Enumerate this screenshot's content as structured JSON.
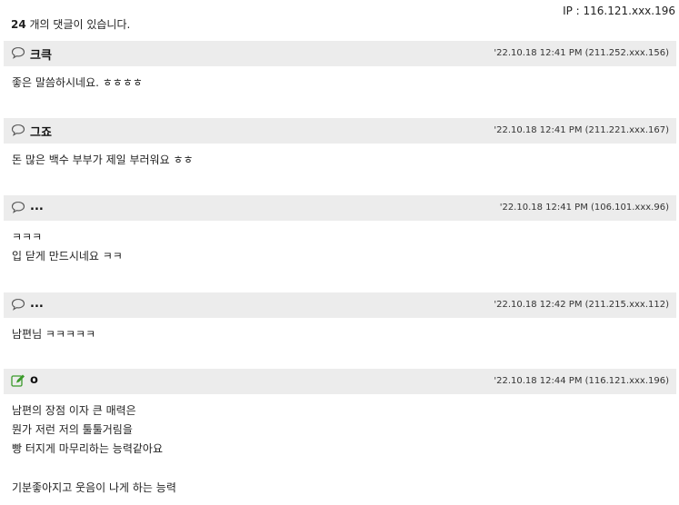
{
  "ip_label": "IP : 116.121.xxx.196",
  "comment_count": "24",
  "comment_count_suffix": " 개의 댓글이 있습니다.",
  "comments": [
    {
      "name": "크큭",
      "meta": "'22.10.18 12:41 PM (211.252.xxx.156)",
      "icon": "speech-bubble-icon",
      "lines": [
        "좋은 말씀하시네요. ㅎㅎㅎㅎ"
      ]
    },
    {
      "name": "그죠",
      "meta": "'22.10.18 12:41 PM (211.221.xxx.167)",
      "icon": "speech-bubble-icon",
      "lines": [
        "돈 많은 백수 부부가 제일 부러워요 ㅎㅎ"
      ]
    },
    {
      "name": "...",
      "meta": "'22.10.18 12:41 PM (106.101.xxx.96)",
      "icon": "speech-bubble-icon",
      "lines": [
        "ㅋㅋㅋ",
        "입 닫게 만드시네요 ㅋㅋ"
      ]
    },
    {
      "name": "...",
      "meta": "'22.10.18 12:42 PM (211.215.xxx.112)",
      "icon": "speech-bubble-icon",
      "lines": [
        "남편님 ㅋㅋㅋㅋㅋ"
      ]
    },
    {
      "name": "o",
      "meta": "'22.10.18 12:44 PM (116.121.xxx.196)",
      "icon": "edit-icon",
      "lines": [
        "남편의 장점 이자 큰 매력은",
        "뭔가 저런 저의 툴툴거림을",
        "빵 터지게 마무리하는 능력같아요",
        "",
        "기분좋아지고 웃음이 나게 하는 능력"
      ]
    }
  ]
}
